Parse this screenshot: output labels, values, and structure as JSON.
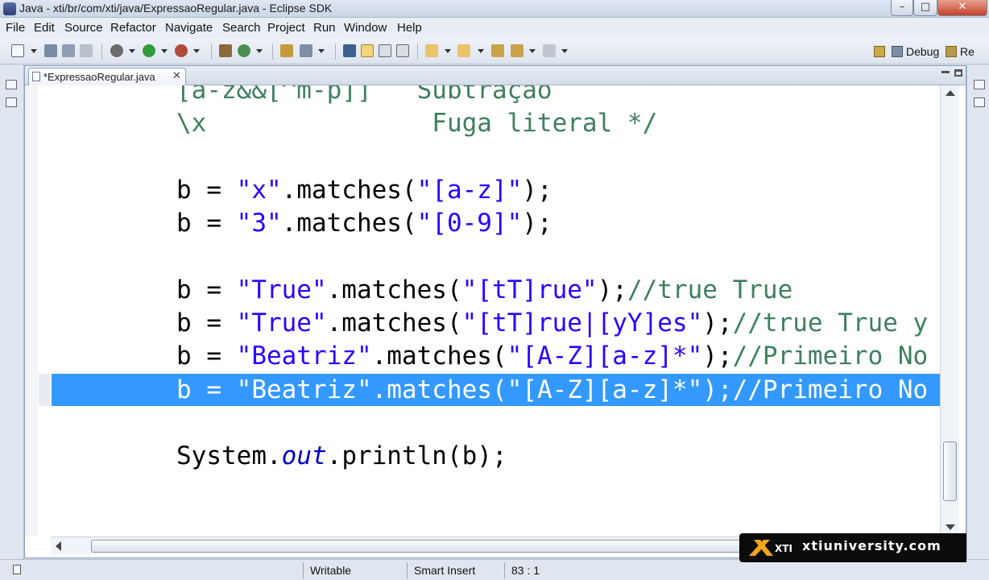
{
  "window": {
    "title": "Java - xti/br/com/xti/java/ExpressaoRegular.java - Eclipse SDK",
    "controls": [
      "minimize",
      "maximize",
      "close"
    ]
  },
  "menu": {
    "items": [
      {
        "label": "File"
      },
      {
        "label": "Edit"
      },
      {
        "label": "Source"
      },
      {
        "label": "Refactor"
      },
      {
        "label": "Navigate"
      },
      {
        "label": "Search"
      },
      {
        "label": "Project"
      },
      {
        "label": "Run"
      },
      {
        "label": "Window"
      },
      {
        "label": "Help"
      }
    ]
  },
  "toolbar": {
    "perspectives": [
      {
        "label": "Debug",
        "icon": "debug-perspective-icon"
      },
      {
        "label": "Re",
        "icon": "resource-perspective-icon"
      }
    ]
  },
  "editor": {
    "tab_label": "*ExpressaoRegular.java",
    "tab_close": "✕",
    "lines": [
      {
        "parts": [
          {
            "t": "[a-z&&[^m-p]]   ",
            "c": "cm"
          },
          {
            "t": "Subtração",
            "c": "cm"
          }
        ]
      },
      {
        "parts": [
          {
            "t": "\\x               ",
            "c": "cm"
          },
          {
            "t": "Fuga literal */",
            "c": "cm"
          }
        ]
      },
      {
        "parts": []
      },
      {
        "parts": [
          {
            "t": "b = ",
            "c": ""
          },
          {
            "t": "\"x\"",
            "c": "kw-str"
          },
          {
            "t": ".matches(",
            "c": ""
          },
          {
            "t": "\"[a-z]\"",
            "c": "kw-str"
          },
          {
            "t": ");",
            "c": ""
          }
        ]
      },
      {
        "parts": [
          {
            "t": "b = ",
            "c": ""
          },
          {
            "t": "\"3\"",
            "c": "kw-str"
          },
          {
            "t": ".matches(",
            "c": ""
          },
          {
            "t": "\"[0-9]\"",
            "c": "kw-str"
          },
          {
            "t": ");",
            "c": ""
          }
        ]
      },
      {
        "parts": []
      },
      {
        "parts": [
          {
            "t": "b = ",
            "c": ""
          },
          {
            "t": "\"True\"",
            "c": "kw-str"
          },
          {
            "t": ".matches(",
            "c": ""
          },
          {
            "t": "\"[tT]rue\"",
            "c": "kw-str"
          },
          {
            "t": ");",
            "c": ""
          },
          {
            "t": "//true True",
            "c": "cm"
          }
        ]
      },
      {
        "parts": [
          {
            "t": "b = ",
            "c": ""
          },
          {
            "t": "\"True\"",
            "c": "kw-str"
          },
          {
            "t": ".matches(",
            "c": ""
          },
          {
            "t": "\"[tT]rue|[yY]es\"",
            "c": "kw-str"
          },
          {
            "t": ");",
            "c": ""
          },
          {
            "t": "//true True y",
            "c": "cm"
          }
        ]
      },
      {
        "parts": [
          {
            "t": "b = ",
            "c": ""
          },
          {
            "t": "\"Beatriz\"",
            "c": "kw-str"
          },
          {
            "t": ".matches(",
            "c": ""
          },
          {
            "t": "\"[A-Z][a-z]*\"",
            "c": "kw-str"
          },
          {
            "t": ");",
            "c": ""
          },
          {
            "t": "//Primeiro No",
            "c": "cm"
          }
        ]
      },
      {
        "selected": true,
        "parts": [
          {
            "t": "b = ",
            "c": ""
          },
          {
            "t": "\"Beatriz\"",
            "c": "kw-str"
          },
          {
            "t": ".matches(",
            "c": ""
          },
          {
            "t": "\"[A-Z][a-z]*\"",
            "c": "kw-str"
          },
          {
            "t": ");",
            "c": ""
          },
          {
            "t": "//Primeiro No",
            "c": "cm"
          }
        ]
      },
      {
        "parts": []
      },
      {
        "parts": [
          {
            "t": "System.",
            "c": ""
          },
          {
            "t": "out",
            "c": "it"
          },
          {
            "t": ".println(b);",
            "c": ""
          }
        ]
      }
    ]
  },
  "status": {
    "writable": "Writable",
    "insert_mode": "Smart Insert",
    "position": "83 : 1"
  },
  "watermark": {
    "logo_text": "XTI",
    "site": "xtiuniversity.com"
  },
  "colors": {
    "selection": "#3399ff",
    "string": "#2a00ff",
    "comment": "#3f7f5f",
    "field": "#0000c0"
  }
}
